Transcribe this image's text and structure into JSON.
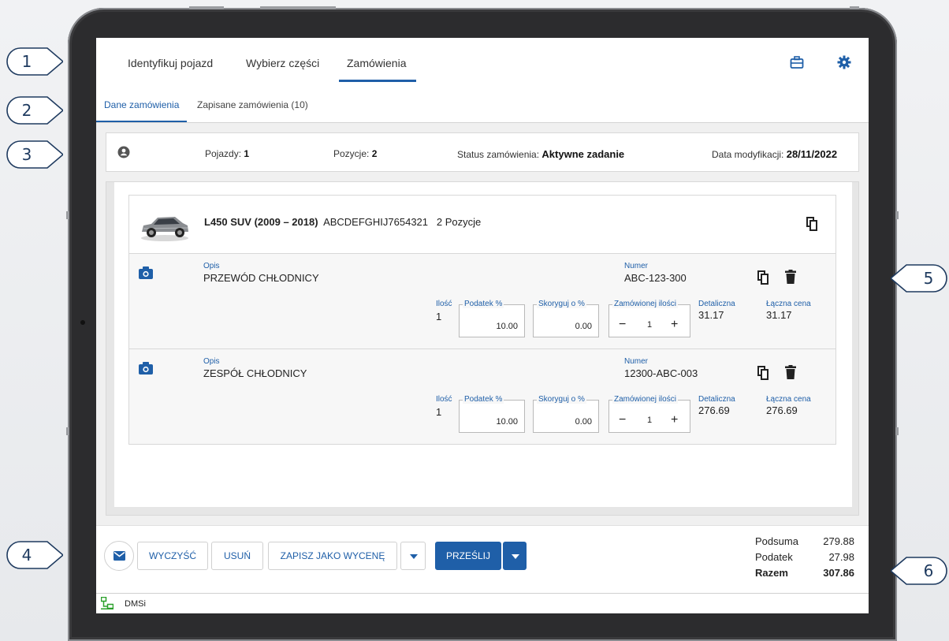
{
  "nav": {
    "tabs": [
      "Identyfikuj pojazd",
      "Wybierz części",
      "Zamówienia"
    ],
    "active_tab": "Zamówienia",
    "icons": [
      "briefcase-icon",
      "gear-icon"
    ]
  },
  "subnav": {
    "tabs": [
      "Dane zamówienia",
      "Zapisane zamówienia (10)"
    ]
  },
  "info": {
    "vehicles_label": "Pojazdy:",
    "vehicles_value": "1",
    "positions_label": "Pozycje:",
    "positions_value": "2",
    "status_label": "Status zamówienia:",
    "status_value": "Aktywne zadanie",
    "modified_label": "Data modyfikacji:",
    "modified_value": "28/11/2022"
  },
  "vehicle": {
    "model": "L450 SUV (2009 – 2018)",
    "vin": "ABCDEFGHIJ7654321",
    "positions": "2 Pozycje"
  },
  "lines": [
    {
      "desc_label": "Opis",
      "desc": "PRZEWÓD CHŁODNICY",
      "num_label": "Numer",
      "num": "ABC-123-300",
      "qty_label": "Ilość",
      "qty": "1",
      "tax_label": "Podatek %",
      "tax": "10.00",
      "adjust_label": "Skoryguj o %",
      "adjust": "0.00",
      "ordered_label": "Zamówionej ilości",
      "ordered": "1",
      "retail_label": "Detaliczna",
      "retail": "31.17",
      "total_label": "Łączna cena",
      "total": "31.17"
    },
    {
      "desc_label": "Opis",
      "desc": "ZESPÓŁ CHŁODNICY",
      "num_label": "Numer",
      "num": "12300-ABC-003",
      "qty_label": "Ilość",
      "qty": "1",
      "tax_label": "Podatek %",
      "tax": "10.00",
      "adjust_label": "Skoryguj o %",
      "adjust": "0.00",
      "ordered_label": "Zamówionej ilości",
      "ordered": "1",
      "retail_label": "Detaliczna",
      "retail": "276.69",
      "total_label": "Łączna cena",
      "total": "276.69"
    }
  ],
  "buttons": {
    "clear": "WYCZYŚĆ",
    "delete": "USUŃ",
    "save_quote": "ZAPISZ JAKO WYCENĘ",
    "send": "PRZEŚLIJ"
  },
  "totals": {
    "subtotal_label": "Podsuma",
    "subtotal": "279.88",
    "tax_label": "Podatek",
    "tax": "27.98",
    "total_label": "Razem",
    "total": "307.86"
  },
  "statusbar": {
    "label": "DMSi"
  },
  "callouts": [
    "1",
    "2",
    "3",
    "4",
    "5",
    "6"
  ],
  "colors": {
    "accent": "#1f5fa8",
    "frame": "#2c2c2e"
  }
}
